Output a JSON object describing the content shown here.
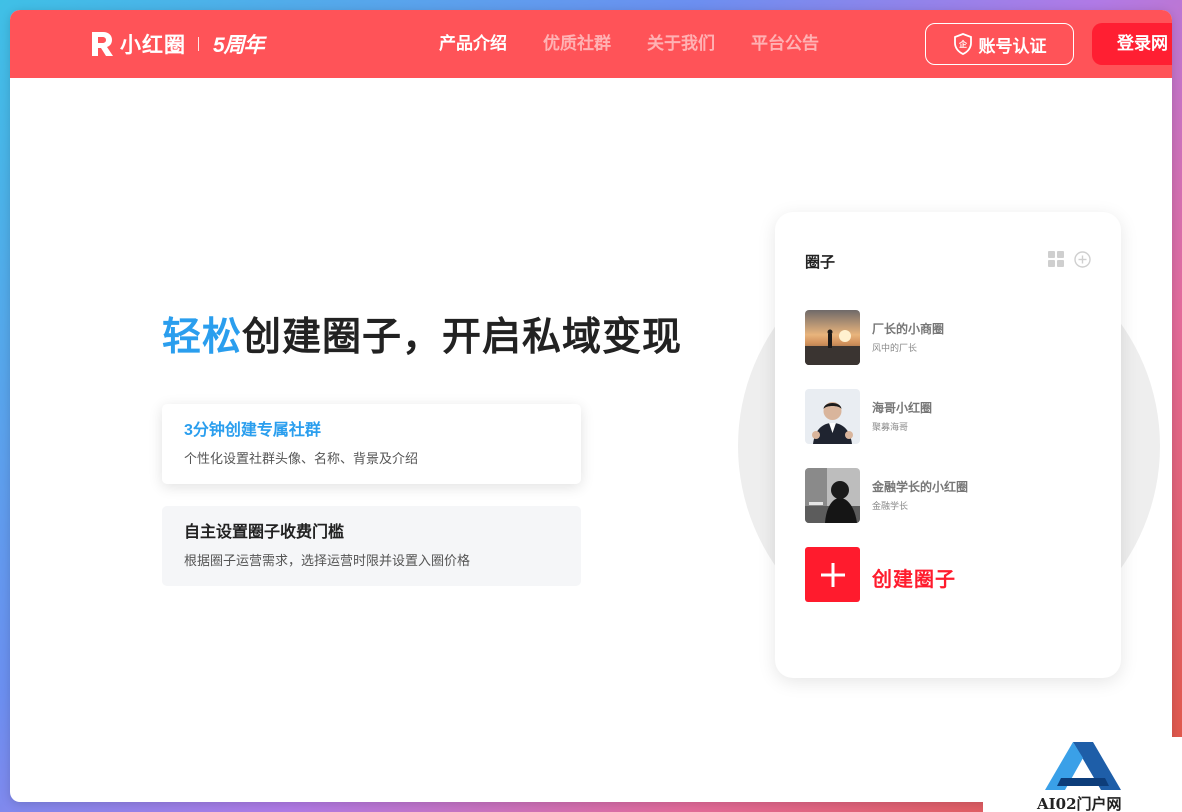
{
  "brand": {
    "name": "小红圈",
    "anniversary": "5周年",
    "color": "#ff5358"
  },
  "nav": {
    "links": [
      {
        "label": "产品介绍",
        "active": true
      },
      {
        "label": "优质社群",
        "active": false
      },
      {
        "label": "关于我们",
        "active": false
      },
      {
        "label": "平台公告",
        "active": false
      }
    ],
    "cert_label": "账号认证",
    "cert_icon": "shield-icon",
    "login_label": "登录网"
  },
  "hero": {
    "headline_highlight": "轻松",
    "headline_rest": "创建圈子，开启私域变现",
    "highlight_color": "#2a9eee"
  },
  "features": [
    {
      "title": "3分钟创建专属社群",
      "desc": "个性化设置社群头像、名称、背景及介绍",
      "active": true
    },
    {
      "title": "自主设置圈子收费门槛",
      "desc": "根据圈子运营需求，选择运营时限并设置入圈价格",
      "active": false
    }
  ],
  "phone": {
    "title": "圈子",
    "icons": [
      "grid-icon",
      "add-circle-icon"
    ],
    "circles": [
      {
        "name": "厂长的小商圈",
        "owner": "风中的厂长"
      },
      {
        "name": "海哥小红圈",
        "owner": "聚募海哥"
      },
      {
        "name": "金融学长的小红圈",
        "owner": "金融学长"
      }
    ],
    "create_label": "创建圈子",
    "create_color": "#ff1b2d"
  },
  "watermark": {
    "text": "AI02门户网"
  }
}
